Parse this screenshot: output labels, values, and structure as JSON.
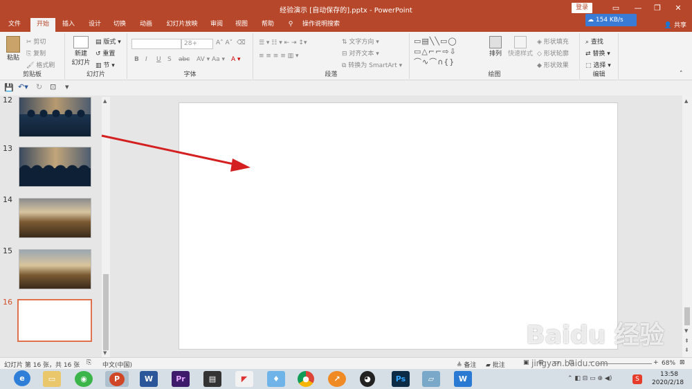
{
  "titlebar": {
    "title": "经验演示 [自动保存的].pptx - PowerPoint",
    "login": "登录"
  },
  "tabs": [
    "文件",
    "开始",
    "插入",
    "设计",
    "切换",
    "动画",
    "幻灯片放映",
    "审阅",
    "视图",
    "帮助"
  ],
  "tell_me": "操作说明搜索",
  "share": "共享",
  "netspeed": "154 KB/s",
  "clipboard": {
    "paste": "粘贴",
    "cut": "剪切",
    "copy": "复制",
    "format_painter": "格式刷",
    "label": "剪贴板"
  },
  "slides_group": {
    "new_slide": "新建",
    "new_slide2": "幻灯片",
    "layout": "版式",
    "reset": "重置",
    "section": "节",
    "label": "幻灯片"
  },
  "font_group": {
    "size": "28+",
    "label": "字体",
    "bold": "B",
    "italic": "I",
    "underline": "U",
    "shadow": "S",
    "strike": "abc"
  },
  "paragraph_group": {
    "text_direction": "文字方向",
    "align_text": "对齐文本",
    "smartart": "转换为 SmartArt",
    "label": "段落"
  },
  "drawing_group": {
    "arrange": "排列",
    "quick_styles": "快速样式",
    "shape_fill": "形状填充",
    "shape_outline": "形状轮廓",
    "shape_effects": "形状效果",
    "label": "绘图"
  },
  "editing_group": {
    "find": "查找",
    "replace": "替换",
    "select": "选择",
    "label": "编辑"
  },
  "slide_numbers": [
    "12",
    "13",
    "14",
    "15",
    "16"
  ],
  "status": {
    "slide_info": "幻灯片 第 16 张，共 16 张",
    "language": "中文(中国)",
    "notes": "备注",
    "comments": "批注",
    "zoom": "68%"
  },
  "taskbar": {
    "time": "13:58",
    "date": "2020/2/18"
  },
  "watermark": {
    "text": "Baidu 经验",
    "url": "jingyan.baidu.com"
  },
  "colors": {
    "accent": "#b7472a",
    "active_slide_border": "#e0704c",
    "arrow": "#d42020"
  }
}
